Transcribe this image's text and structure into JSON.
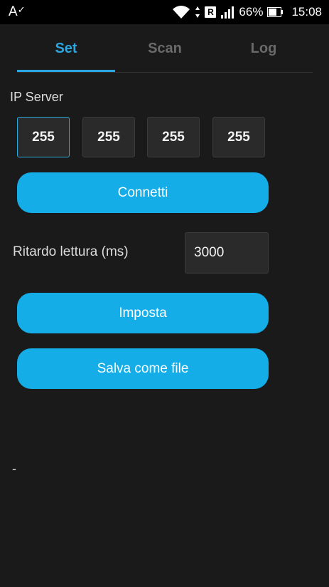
{
  "status_bar": {
    "left_glyph": "A",
    "battery_percent": "66%",
    "time": "15:08",
    "r_badge": "R"
  },
  "tabs": [
    {
      "label": "Set",
      "active": true
    },
    {
      "label": "Scan",
      "active": false
    },
    {
      "label": "Log",
      "active": false
    }
  ],
  "ip_server": {
    "label": "IP Server",
    "octets": [
      "255",
      "255",
      "255",
      "255"
    ]
  },
  "buttons": {
    "connect": "Connetti",
    "set": "Imposta",
    "save_file": "Salva come file"
  },
  "read_delay": {
    "label": "Ritardo lettura (ms)",
    "value": "3000"
  },
  "status_text": "-",
  "colors": {
    "accent": "#2ba6e0",
    "button": "#14ade8",
    "background": "#1a1a1a"
  }
}
